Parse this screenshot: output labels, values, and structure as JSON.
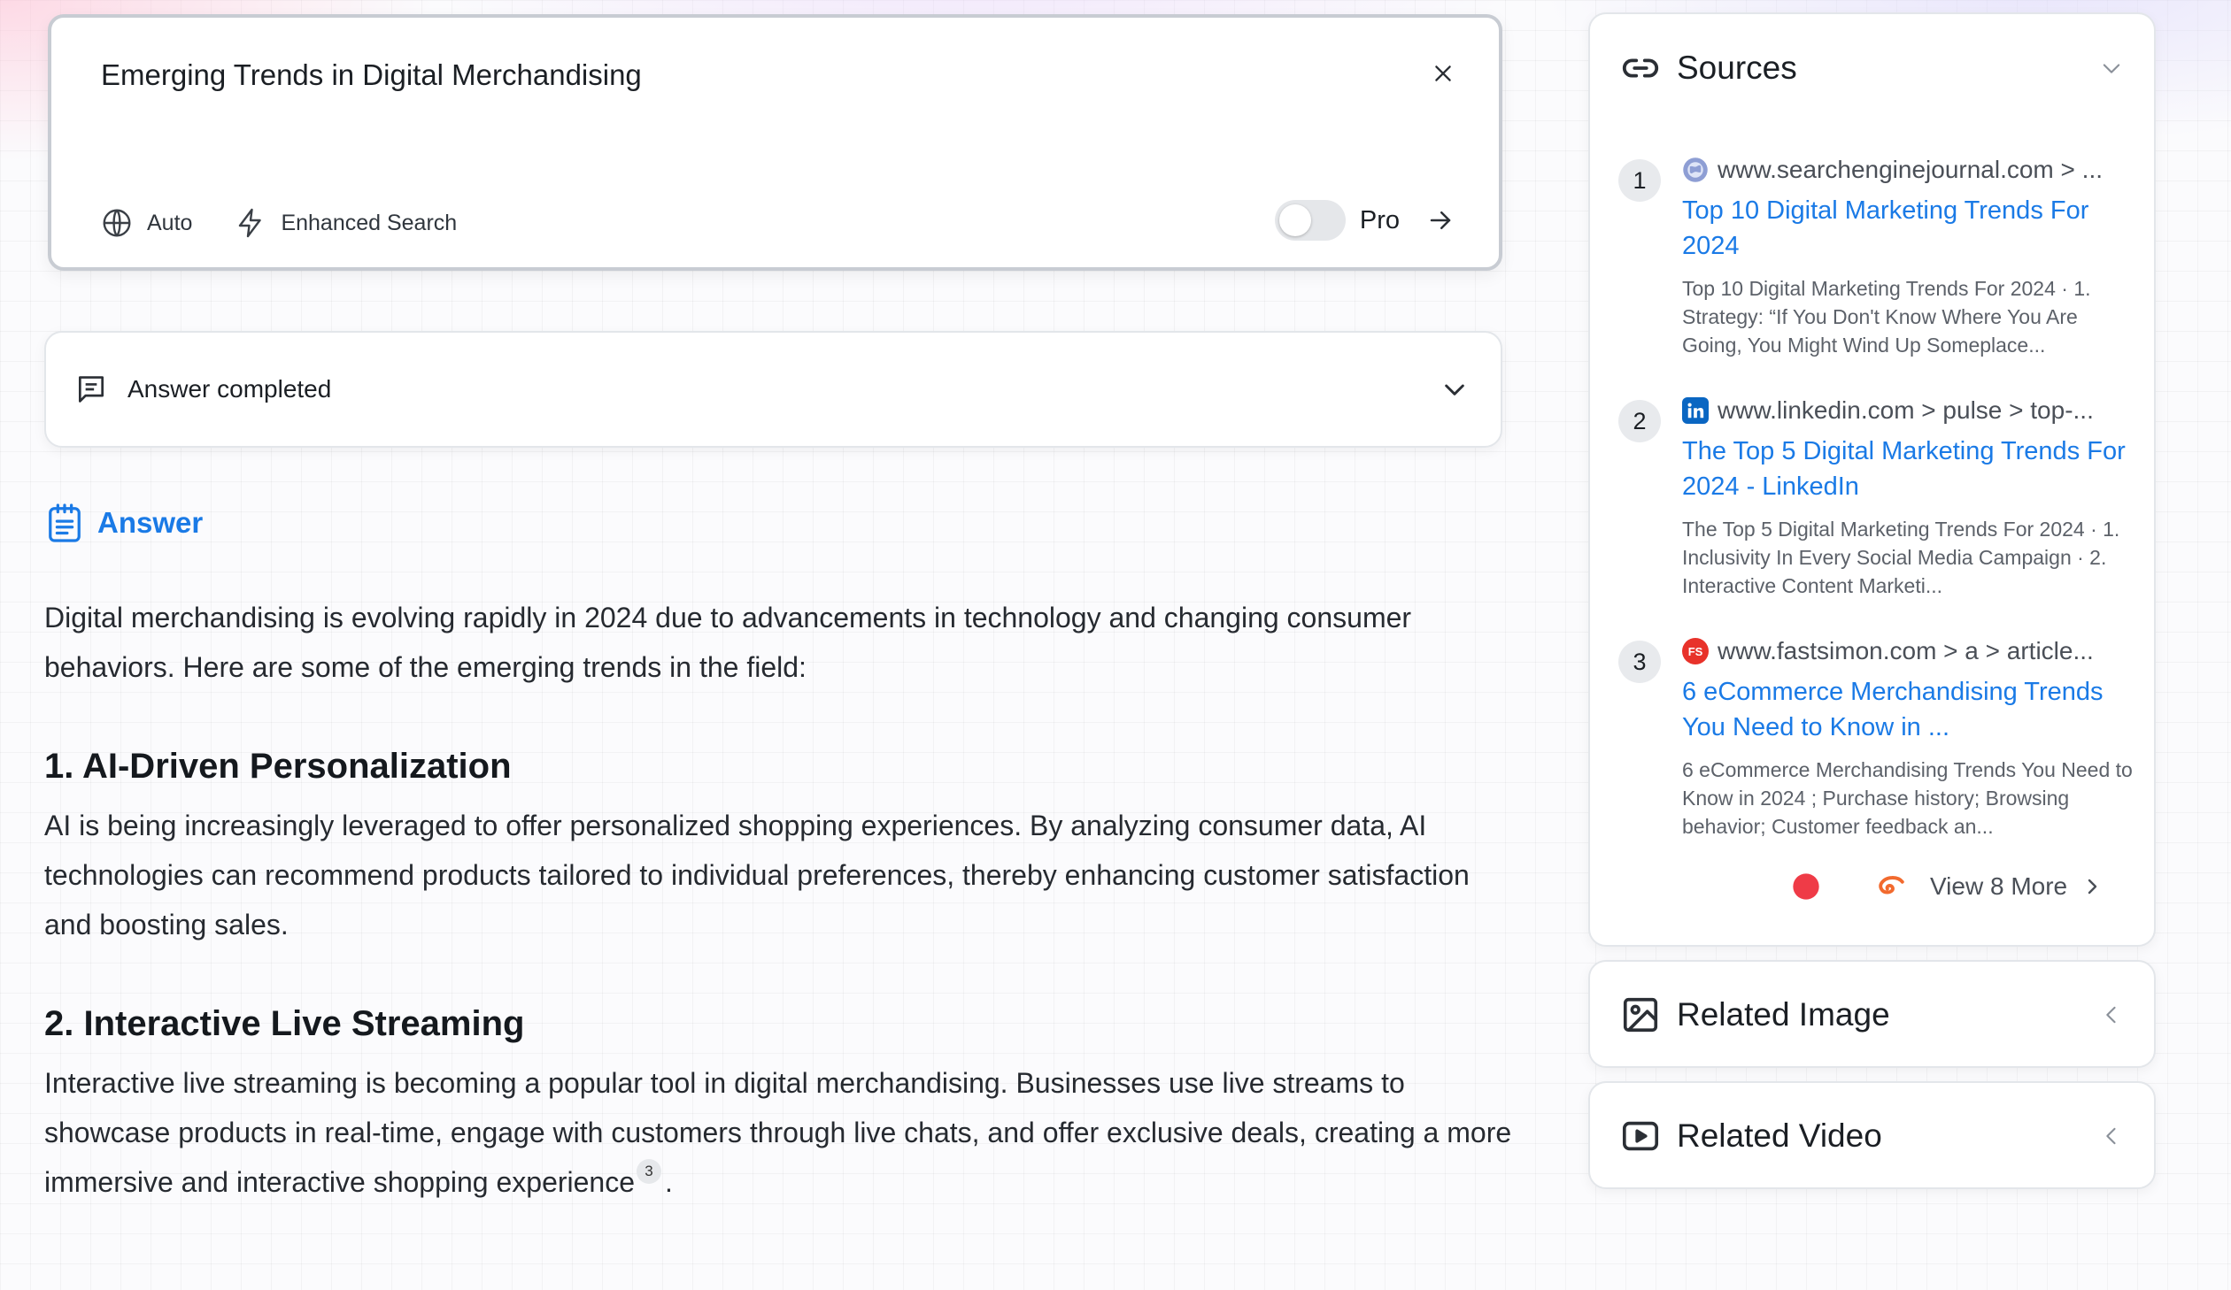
{
  "search": {
    "query": "Emerging Trends in Digital Merchandising",
    "tools": [
      {
        "label": "Auto",
        "icon": "globe-icon"
      },
      {
        "label": "Enhanced Search",
        "icon": "lightning-icon"
      }
    ],
    "pro_label": "Pro",
    "pro_enabled": false
  },
  "status": {
    "label": "Answer completed"
  },
  "answer": {
    "heading": "Answer",
    "intro": "Digital merchandising is evolving rapidly in 2024 due to advancements in technology and changing consumer behaviors. Here are some of the emerging trends in the field:",
    "sections": [
      {
        "heading": "1. AI-Driven Personalization",
        "body": "AI is being increasingly leveraged to offer personalized shopping experiences. By analyzing consumer data, AI technologies can recommend products tailored to individual preferences, thereby enhancing customer satisfaction and boosting sales."
      },
      {
        "heading": "2. Interactive Live Streaming",
        "body": "Interactive live streaming is becoming a popular tool in digital merchandising. Businesses use live streams to showcase products in real-time, engage with customers through live chats, and offer exclusive deals, creating a more immersive and interactive shopping experience",
        "citation": "3",
        "trailing": "."
      }
    ]
  },
  "sources": {
    "title": "Sources",
    "items": [
      {
        "number": "1",
        "domain": "www.searchenginejournal.com > ...",
        "title": "Top 10 Digital Marketing Trends For 2024",
        "snippet": "Top 10 Digital Marketing Trends For 2024 · 1. Strategy: “If You Don't Know Where You Are Going, You Might Wind Up Someplace...",
        "favicon_color": "#7d8fc9"
      },
      {
        "number": "2",
        "domain": "www.linkedin.com > pulse > top-...",
        "title": "The Top 5 Digital Marketing Trends For 2024 - LinkedIn",
        "snippet": "The Top 5 Digital Marketing Trends For 2024 · 1. Inclusivity In Every Social Media Campaign · 2. Interactive Content Marketi...",
        "favicon_color": "#0a66c2",
        "favicon_text": "in"
      },
      {
        "number": "3",
        "domain": "www.fastsimon.com > a > article...",
        "title": "6 eCommerce Merchandising Trends You Need to Know in ...",
        "snippet": "6 eCommerce Merchandising Trends You Need to Know in 2024 ; Purchase history; Browsing behavior; Customer feedback an...",
        "favicon_color": "#e8322a",
        "favicon_text": "FS"
      }
    ],
    "view_more": "View 8 More"
  },
  "related_image": {
    "title": "Related Image"
  },
  "related_video": {
    "title": "Related Video"
  },
  "colors": {
    "accent": "#1a7ae6",
    "badge": "#e8eaed"
  }
}
